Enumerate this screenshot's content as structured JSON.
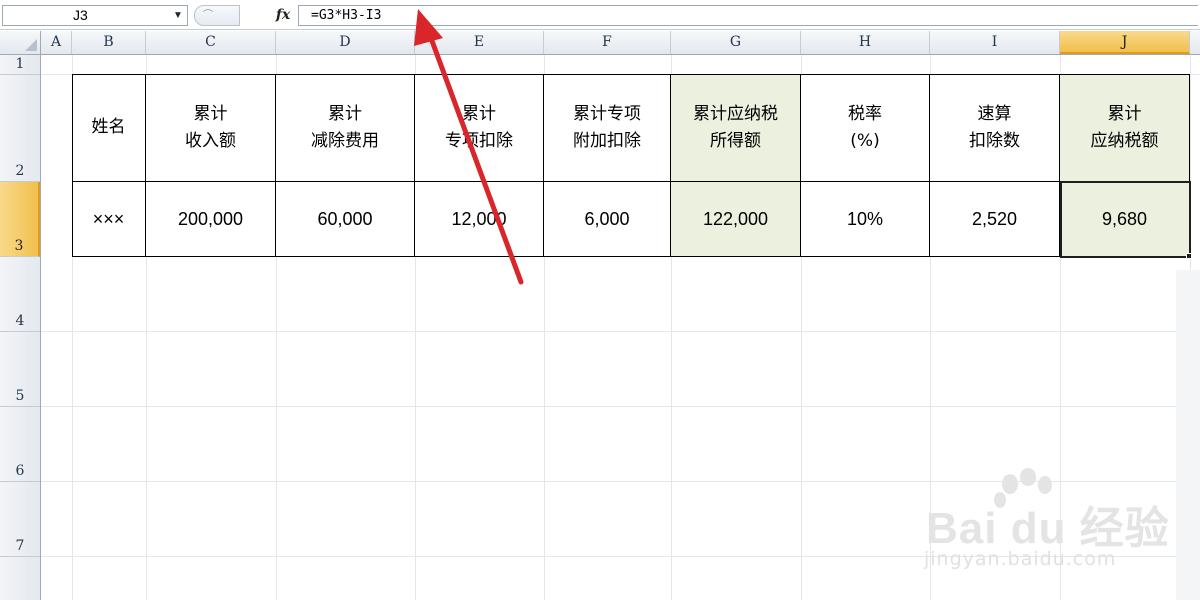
{
  "formula_bar": {
    "name_box": "J3",
    "fx_label": "fx",
    "formula": "=G3*H3-I3"
  },
  "columns": [
    "A",
    "B",
    "C",
    "D",
    "E",
    "F",
    "G",
    "H",
    "I",
    "J"
  ],
  "rows": [
    "1",
    "2",
    "3",
    "4",
    "5",
    "6",
    "7"
  ],
  "selected_cell": {
    "column": "J",
    "row": "3"
  },
  "table": {
    "headers": [
      [
        "姓名"
      ],
      [
        "累计",
        "收入额"
      ],
      [
        "累计",
        "减除费用"
      ],
      [
        "累计",
        "专项扣除"
      ],
      [
        "累计专项",
        "附加扣除"
      ],
      [
        "累计应纳税",
        "所得额"
      ],
      [
        "税率",
        "(%)"
      ],
      [
        "速算",
        "扣除数"
      ],
      [
        "累计",
        "应纳税额"
      ]
    ],
    "values": [
      "×××",
      "200,000",
      "60,000",
      "12,000",
      "6,000",
      "122,000",
      "10%",
      "2,520",
      "9,680"
    ]
  },
  "colors": {
    "shaded_fill": "#ebf1de",
    "selection_header": "#f1c04d",
    "arrow": "#d9262b"
  },
  "watermark": {
    "brand": "Bai du 经验",
    "url": "jingyan.baidu.com"
  }
}
